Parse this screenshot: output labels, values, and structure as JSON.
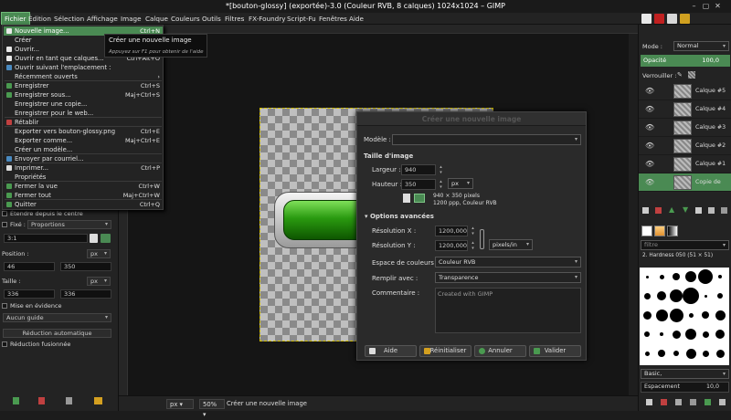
{
  "window": {
    "title": "*[bouton-glossy] (exportée)-3.0 (Couleur RVB, 8 calques) 1024x1024 – GIMP"
  },
  "menubar": [
    "Fichier",
    "Édition",
    "Sélection",
    "Affichage",
    "Image",
    "Calque",
    "Couleurs",
    "Outils",
    "Filtres",
    "FX-Foundry",
    "Script-Fu",
    "Fenêtres",
    "Aide"
  ],
  "file_menu": [
    {
      "label": "Nouvelle image...",
      "shortcut": "Ctrl+N"
    },
    {
      "label": "Créer",
      "shortcut": ""
    },
    {
      "label": "Ouvrir...",
      "shortcut": ""
    },
    {
      "label": "Ouvrir en tant que calques...",
      "shortcut": "Ctrl+Alt+O"
    },
    {
      "label": "Ouvrir suivant l'emplacement :",
      "shortcut": ""
    },
    {
      "label": "Récemment ouverts",
      "shortcut": "›"
    },
    {
      "label": "Enregistrer",
      "shortcut": "Ctrl+S"
    },
    {
      "label": "Enregistrer sous...",
      "shortcut": "Maj+Ctrl+S"
    },
    {
      "label": "Enregistrer une copie...",
      "shortcut": ""
    },
    {
      "label": "Enregistrer pour le web...",
      "shortcut": ""
    },
    {
      "label": "Rétablir",
      "shortcut": ""
    },
    {
      "label": "Exporter vers bouton-glossy.png",
      "shortcut": "Ctrl+E"
    },
    {
      "label": "Exporter comme...",
      "shortcut": "Maj+Ctrl+E"
    },
    {
      "label": "Créer un modèle...",
      "shortcut": ""
    },
    {
      "label": "Envoyer par courriel...",
      "shortcut": ""
    },
    {
      "label": "Imprimer...",
      "shortcut": "Ctrl+P"
    },
    {
      "label": "Propriétés",
      "shortcut": ""
    },
    {
      "label": "Fermer la vue",
      "shortcut": "Ctrl+W"
    },
    {
      "label": "Fermer tout",
      "shortcut": "Maj+Ctrl+W"
    },
    {
      "label": "Quitter",
      "shortcut": "Ctrl+Q"
    }
  ],
  "tooltip": {
    "title": "Créer une nouvelle image",
    "hint": "Appuyez sur F1 pour obtenir de l'aide"
  },
  "tool_options": {
    "center_label": "Étendre depuis le centre",
    "fixed_label": "Fixé :",
    "fixed_value": "Proportions",
    "ratio": "3:1",
    "position_label": "Position :",
    "pos_x": "46",
    "pos_y": "350",
    "pos_unit": "px",
    "size_label": "Taille :",
    "size_w": "336",
    "size_h": "336",
    "size_unit": "px",
    "highlight_label": "Mise en évidence",
    "guides_value": "Aucun guide",
    "auto_shrink_label": "Réduction automatique",
    "merged_label": "Réduction fusionnée"
  },
  "dialog": {
    "title": "Créer une nouvelle image",
    "template_label": "Modèle :",
    "template_value": "",
    "size_header": "Taille d'image",
    "width_label": "Largeur :",
    "width": "940",
    "height_label": "Hauteur :",
    "height": "350",
    "unit": "px",
    "info1": "940 × 350 pixels",
    "info2": "1200 ppp, Couleur RVB",
    "advanced": "Options avancées",
    "resx_label": "Résolution X :",
    "resx": "1200,000",
    "resy_label": "Résolution Y :",
    "resy": "1200,000",
    "res_unit": "pixels/in",
    "colorspace_label": "Espace de couleurs :",
    "colorspace": "Couleur RVB",
    "fill_label": "Remplir avec :",
    "fill": "Transparence",
    "comment_label": "Commentaire :",
    "comment": "Created with GIMP",
    "buttons": [
      "Aide",
      "Réinitialiser",
      "Annuler",
      "Valider"
    ]
  },
  "layers_panel": {
    "mode_label": "Mode :",
    "mode": "Normal",
    "opacity_label": "Opacité",
    "opacity": "100,0",
    "lock_label": "Verrouiller :",
    "layers": [
      "Calque #5",
      "Calque #4",
      "Calque #3",
      "Calque #2",
      "Calque #1",
      "Copie de"
    ]
  },
  "brushes_panel": {
    "filter": "filtre",
    "brush_name": "2. Hardness 050 (51 × 51)",
    "tag": "Basic,",
    "spacing_label": "Espacement",
    "spacing": "10,0"
  },
  "statusbar": {
    "unit": "px",
    "zoom": "50%",
    "message": "Créer une nouvelle image"
  },
  "colors": {
    "accent": "#4a8a53",
    "selection": "#d4c000",
    "button_green": "#2a9a10"
  }
}
